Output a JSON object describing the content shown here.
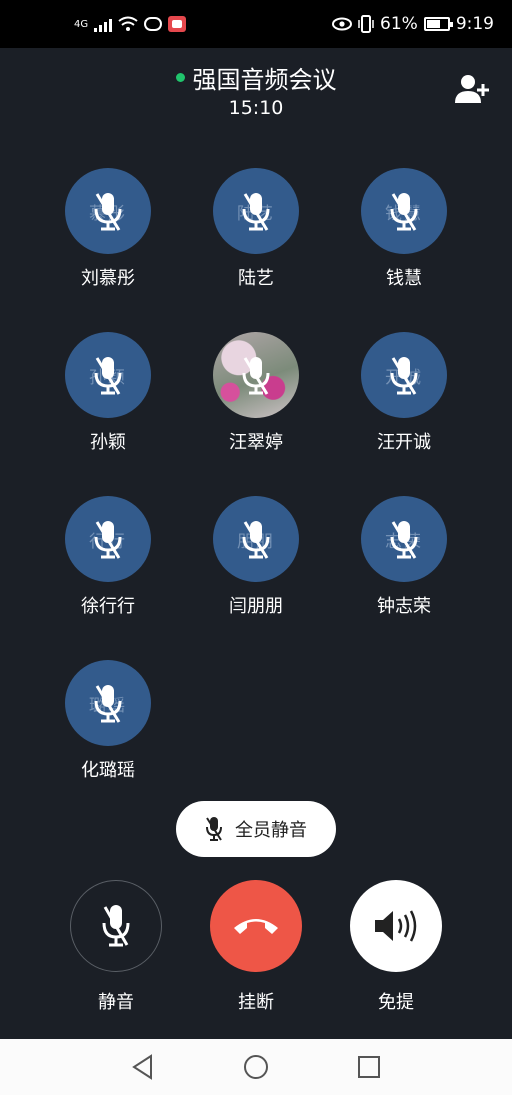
{
  "status_bar": {
    "network": "4G",
    "battery_percent": "61%",
    "time": "9:19"
  },
  "header": {
    "title": "强国音频会议",
    "timer": "15:10",
    "dot_color": "#20c46c"
  },
  "members": [
    {
      "name": "刘慕彤",
      "avatar_text": "慕彤",
      "muted": true
    },
    {
      "name": "陆艺",
      "avatar_text": "陆艺",
      "muted": true
    },
    {
      "name": "钱慧",
      "avatar_text": "钱慧",
      "muted": true
    },
    {
      "name": "孙颖",
      "avatar_text": "孙颖",
      "muted": true
    },
    {
      "name": "汪翠婷",
      "avatar_text": "",
      "photo": true,
      "muted": true
    },
    {
      "name": "汪开诚",
      "avatar_text": "开诚",
      "muted": true
    },
    {
      "name": "徐行行",
      "avatar_text": "行行",
      "muted": true
    },
    {
      "name": "闫朋朋",
      "avatar_text": "朋朋",
      "muted": true
    },
    {
      "name": "钟志荣",
      "avatar_text": "志荣",
      "muted": true
    },
    {
      "name": "化璐瑶",
      "avatar_text": "璐瑶",
      "muted": true
    }
  ],
  "mute_all": {
    "label": "全员静音"
  },
  "controls": {
    "mute_label": "静音",
    "hangup_label": "挂断",
    "speaker_label": "免提",
    "hangup_color": "#ee5647",
    "avatar_color": "#335b8c"
  }
}
